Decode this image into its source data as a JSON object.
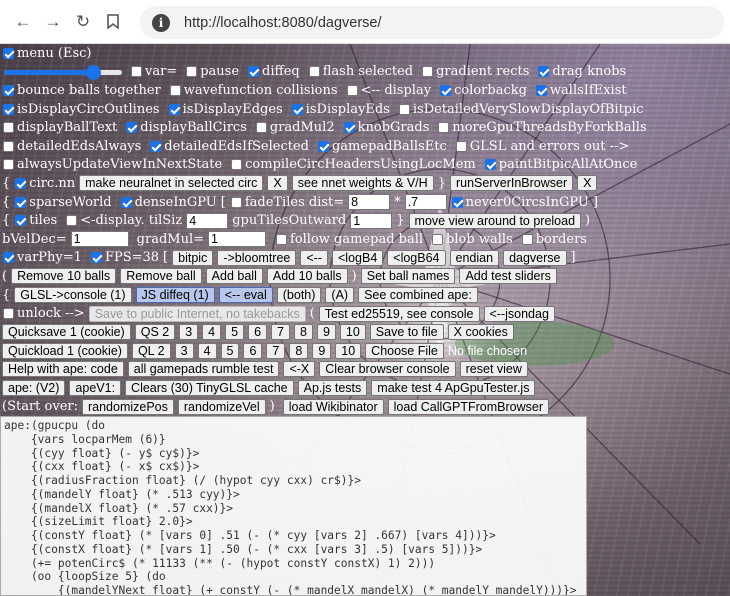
{
  "browser": {
    "url": "http://localhost:8080/dagverse/",
    "back_icon": "arrow-left-icon",
    "forward_icon": "arrow-right-icon",
    "reload_icon": "reload-icon",
    "bookmark_icon": "bookmark-icon",
    "info_icon": "info-icon"
  },
  "controls": {
    "menu": "menu (Esc)",
    "var_eq": "var=",
    "pause": "pause",
    "diffeq": "diffeq",
    "flash_selected": "flash selected",
    "gradient_rects": "gradient rects",
    "drag_knobs": "drag knobs",
    "bounce_balls": "bounce balls together",
    "wavefunction": "wavefunction collisions",
    "display_arrow": "<-- display",
    "colorbackg": "colorbackg",
    "walls_if_exist": "wallsIfExist",
    "circ_outlines": "isDisplayCircOutlines",
    "display_edges": "isDisplayEdges",
    "display_eds": "isDisplayEds",
    "detailed_slow": "isDetailedVerySlowDisplayOfBitpic",
    "display_ball_text": "displayBallText",
    "display_ball_circs": "displayBallCircs",
    "grad_mul2": "gradMul2",
    "knob_grads": "knobGrads",
    "more_gpu_threads": "moreGpuThreadsByForkBalls",
    "detailed_eds_always": "detailedEdsAlways",
    "detailed_eds_if_selected": "detailedEdsIfSelected",
    "gamepad_balls": "gamepadBallsEtc",
    "glsl_errors": "GLSL and errors out -->",
    "always_update": "alwaysUpdateViewInNextState",
    "compile_circ": "compileCircHeadersUsingLocMem",
    "paint_bitpic": "paintBitpicAllAtOnce",
    "brace_open": "{",
    "brace_close": "}",
    "circ_nn": "circ.nn",
    "make_neuralnet": "make neuralnet in selected circ",
    "x_label": "X",
    "see_nnet": "see nnet weights & V/H",
    "run_server": "runServerInBrowser",
    "sparse_world": "sparseWorld",
    "dense_in_gpu": "denseInGPU",
    "bracket_open": "[",
    "bracket_close": "]",
    "fade_tiles": "fadeTiles dist=",
    "fade_dist": "8",
    "times": "*",
    "fade_mult": ".7",
    "never0": "never0CircsInGPU",
    "tiles": "tiles",
    "display_til_siz": "<-display. tilSiz",
    "til_siz": "4",
    "gpu_tiles_outward": "gpuTilesOutward",
    "gpu_tiles_value": "1",
    "move_view": "move view around to preload",
    "paren_close": ")",
    "paren_open": "(",
    "bvel_dec": "bVelDec=",
    "bvel_value": "1",
    "grad_mul": "gradMul=",
    "grad_mul_value": "1",
    "follow_gamepad": "follow gamepad ball",
    "blob_walls": "blob walls",
    "borders": "borders",
    "varphy": "varPhy=1",
    "fps": "FPS=38",
    "bitpic": "bitpic",
    "bloomtree": "->bloomtree",
    "arrow_left": "<--",
    "logb4": "<logB4",
    "logb64": "<logB64",
    "endian": "endian",
    "dagverse": "dagverse",
    "remove10": "Remove 10 balls",
    "remove_ball": "Remove ball",
    "add_ball": "Add ball",
    "add10": "Add 10 balls",
    "set_ball_names": "Set ball names",
    "add_test_sliders": "Add test sliders",
    "glsl_console": "GLSL->console (1)",
    "js_diffeq": "JS diffeq (1)",
    "eval": "<-- eval",
    "both": "(both)",
    "a": "(A)",
    "see_combined": "See combined ape:",
    "unlock": "unlock -->",
    "save_public": "Save to public Internet, no takebacks",
    "test_ed": "Test ed25519, see console",
    "jsondag": "<--jsondag",
    "quicksave": "Quicksave 1 (cookie)",
    "qs2": "QS 2",
    "slots_qs": [
      "3",
      "4",
      "5",
      "6",
      "7",
      "8",
      "9",
      "10"
    ],
    "save_to_file": "Save to file",
    "x_cookies": "X cookies",
    "quickload": "Quickload 1 (cookie)",
    "ql2": "QL 2",
    "slots_ql": [
      "3",
      "4",
      "5",
      "6",
      "7",
      "8",
      "9",
      "10"
    ],
    "choose_file": "Choose File",
    "no_file": "No file chosen",
    "help_ape": "Help with ape: code",
    "all_gamepads": "all gamepads rumble test",
    "x_arrow": "<-X",
    "clear_console": "Clear browser console",
    "reset_view": "reset view",
    "ape_v2": "ape: (V2)",
    "ape_v1": "apeV1:",
    "clears_cache": "Clears (30) TinyGLSL cache",
    "apjs_tests": "Ap.js tests",
    "make_test4": "make test 4 ApGpuTester.js",
    "start_over": "(Start over:",
    "randomize_pos": "randomizePos",
    "randomize_vel": "randomizeVel",
    "load_wikibinator": "load Wikibinator",
    "load_callgpt": "load CallGPTFromBrowser",
    "slider_fraction": 0.75
  },
  "code": "ape:(gpucpu (do\n    {vars locparMem (6)}\n    {(cyy float} (- y$ cy$)}>\n    {(cxx float} (- x$ cx$)}>\n    {(radiusFraction float} (/ (hypot cyy cxx) cr$)}>\n    {(mandelY float} (* .513 cyy)}>\n    {(mandelX float} (* .57 cxx)}>\n    {(sizeLimit float} 2.0}>\n    {(constY float} (* [vars 0] .51 (- (* cyy [vars 2] .667) [vars 4]))}>\n    {(constX float} (* [vars 1] .50 (- (* cxx [vars 3] .5) [vars 5]))}>\n    (+= potenCirc$ (* 11133 (** (- (hypot constY constX) 1) 2)))\n    (oo {loopSize 5} (do\n        {(mandelYNext float} (+ constY (- (* mandelX mandelX) (* mandelY mandelY)))}>"
}
